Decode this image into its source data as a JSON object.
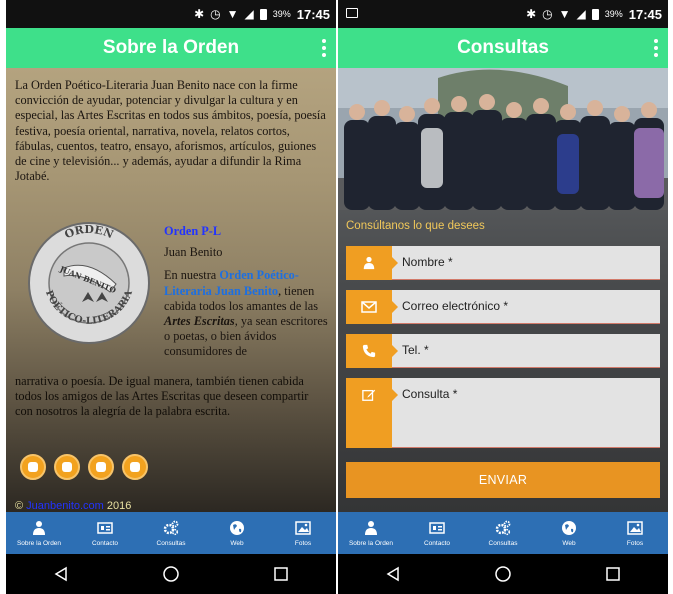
{
  "left_screen": {
    "status": {
      "battery": "39%",
      "time": "17:45"
    },
    "title": "Sobre la Orden",
    "intro": "La Orden Poético-Literaria Juan Benito nace con la firme convicción de ayudar, potenciar y divulgar la cultura y en especial, las Artes Escritas en todos sus ámbitos, poesía, poesía festiva, poesía oriental, narrativa, novela, relatos cortos, fábulas, cuentos, teatro, ensayo, aforismos, artículos, guiones de cine y televisión... y además, ayudar a difundir la Rima Jotabé.",
    "seal": {
      "top": "ORDEN",
      "middle": "JUAN BENITO",
      "bottom": "POÉTICO-LITERARIA"
    },
    "side": {
      "org": "Orden P-L",
      "name": "Juan Benito",
      "text_a": "En nuestra ",
      "text_hl": "Orden Poético-Literaria Juan Benito",
      "text_b": ", tienen cabida todos los amantes de las ",
      "text_em": "Artes Escritas",
      "text_c": ", ya sean escritores o poetas, o bien ávidos consumidores de"
    },
    "continuation": "narrativa o poesía. De igual manera, también tienen cabida todos los amigos de las Artes Escritas que deseen compartir con nosotros la alegría de la palabra escrita.",
    "copyright": {
      "symbol": "©",
      "link": "Juanbenito.com",
      "year": "2016"
    }
  },
  "right_screen": {
    "status": {
      "battery": "39%",
      "time": "17:45"
    },
    "title": "Consultas",
    "form_title": "Consúltanos lo que desees",
    "fields": {
      "name": "Nombre *",
      "email": "Correo electrónico *",
      "phone": "Tel. *",
      "query": "Consulta *"
    },
    "send_label": "ENVIAR"
  },
  "tabs": [
    {
      "label": "Sobre la Orden",
      "icon": "person-icon"
    },
    {
      "label": "Contacto",
      "icon": "contact-card-icon"
    },
    {
      "label": "Consultas",
      "icon": "gears-icon"
    },
    {
      "label": "Web",
      "icon": "globe-icon"
    },
    {
      "label": "Fotos",
      "icon": "image-icon"
    }
  ],
  "colors": {
    "appbar": "#3ee08a",
    "tabbar": "#2d6fb4",
    "accent": "#f09e22",
    "link": "#2233ff"
  }
}
